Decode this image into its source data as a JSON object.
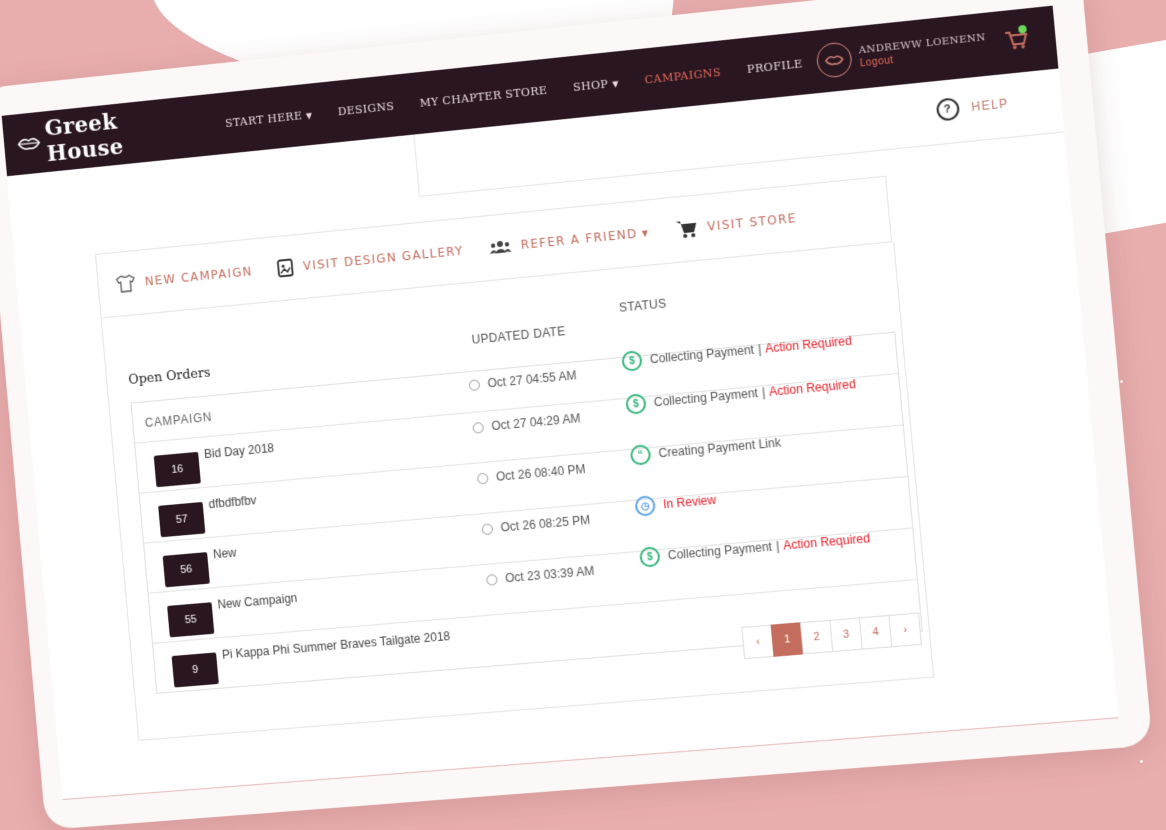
{
  "brand": {
    "name": "Greek House"
  },
  "nav": {
    "items": [
      {
        "label": "START HERE",
        "dropdown": true
      },
      {
        "label": "DESIGNS",
        "dropdown": false
      },
      {
        "label": "MY CHAPTER STORE",
        "dropdown": false
      },
      {
        "label": "SHOP",
        "dropdown": true
      },
      {
        "label": "CAMPAIGNS",
        "dropdown": false,
        "active": true
      },
      {
        "label": "PROFILE",
        "dropdown": false
      }
    ],
    "user_name": "ANDREWW LOENENN",
    "logout": "Logout"
  },
  "help": {
    "label": "HELP"
  },
  "actions": {
    "new_campaign": "NEW CAMPAIGN",
    "visit_gallery": "VISIT DESIGN GALLERY",
    "refer_friend": "REFER A FRIEND",
    "visit_store": "VISIT STORE"
  },
  "orders": {
    "title": "Open Orders",
    "col_campaign": "CAMPAIGN",
    "col_updated": "UPDATED DATE",
    "col_status": "STATUS",
    "rows": [
      {
        "num": "16",
        "name": "Bid Day 2018",
        "date": "Oct 27 04:55 AM",
        "status": "Collecting Payment",
        "action": "Action Required",
        "icon": "$"
      },
      {
        "num": "57",
        "name": "dfbdfbfbv",
        "date": "Oct 27 04:29 AM",
        "status": "Collecting Payment",
        "action": "Action Required",
        "icon": "$"
      },
      {
        "num": "56",
        "name": "New",
        "date": "Oct 26 08:40 PM",
        "status": "Creating Payment Link",
        "action": "",
        "icon": "“"
      },
      {
        "num": "55",
        "name": "New Campaign",
        "date": "Oct 26 08:25 PM",
        "status": "In Review",
        "action": "",
        "icon": "◷"
      },
      {
        "num": "9",
        "name": "Pi Kappa Phi Summer Braves Tailgate 2018",
        "date": "Oct 23 03:39 AM",
        "status": "Collecting Payment",
        "action": "Action Required",
        "icon": "$"
      }
    ]
  },
  "pagination": {
    "prev": "‹",
    "pages": [
      "1",
      "2",
      "3",
      "4"
    ],
    "next": "›",
    "current": "1"
  },
  "colors": {
    "nav_bg": "#2a1620",
    "accent": "#c46d5e",
    "active_nav": "#e86b5b",
    "alert": "#e8212c",
    "ok": "#34b57a"
  }
}
